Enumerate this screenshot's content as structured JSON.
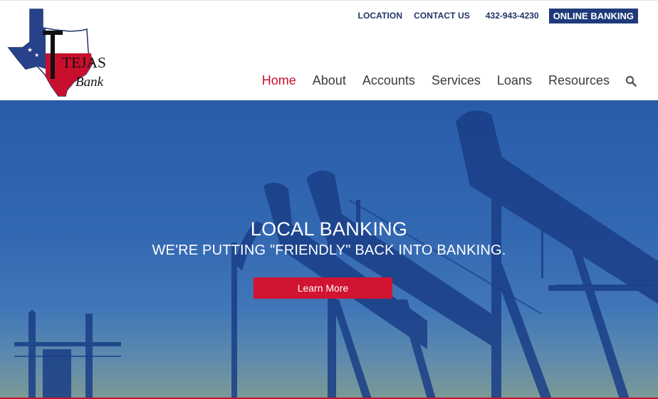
{
  "brand": {
    "logo_word": "TEJAS",
    "logo_sub": "Bank",
    "colors": {
      "navy": "#1f3a7a",
      "red": "#c8102e",
      "text": "#3b3b3b"
    }
  },
  "topbar": {
    "location": "LOCATION",
    "contact": "CONTACT US",
    "phone": "432-943-4230",
    "online_banking": "ONLINE BANKING"
  },
  "nav": {
    "items": [
      {
        "label": "Home",
        "active": true
      },
      {
        "label": "About"
      },
      {
        "label": "Accounts"
      },
      {
        "label": "Services"
      },
      {
        "label": "Loans"
      },
      {
        "label": "Resources"
      }
    ],
    "search_icon": "search-icon"
  },
  "hero": {
    "title": "LOCAL BANKING",
    "subtitle": "WE'RE PUTTING \"FRIENDLY\" BACK INTO BANKING.",
    "button": "Learn More"
  }
}
